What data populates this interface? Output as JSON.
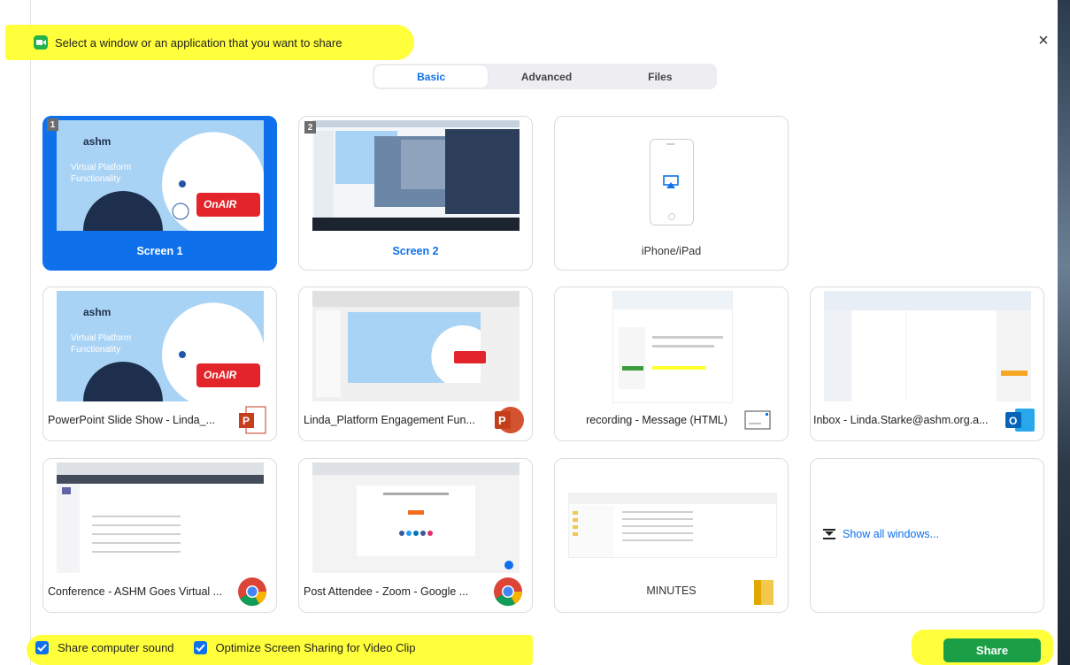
{
  "header": {
    "title": "Select a window or an application that you want to share",
    "close_symbol": "×"
  },
  "tabs": [
    {
      "label": "Basic",
      "active": true
    },
    {
      "label": "Advanced",
      "active": false
    },
    {
      "label": "Files",
      "active": false
    }
  ],
  "tiles": {
    "screen1": {
      "label": "Screen 1",
      "badge": "1",
      "selected": true,
      "slide_brand": "ashm",
      "slide_title": "Virtual Platform",
      "slide_subtitle": "Functionality",
      "slide_onair": "OnAIR"
    },
    "screen2": {
      "label": "Screen 2",
      "badge": "2"
    },
    "iphone": {
      "label": "iPhone/iPad"
    },
    "ppt_show": {
      "label": "PowerPoint Slide Show  -  Linda_...",
      "app_icon": "powerpoint-icon",
      "slide_brand": "ashm",
      "slide_title": "Virtual Platform",
      "slide_subtitle": "Functionality",
      "slide_onair": "OnAIR"
    },
    "ppt_edit": {
      "label": "Linda_Platform Engagement Fun...",
      "app_icon": "powerpoint-icon"
    },
    "recording": {
      "label": "recording - Message (HTML)",
      "app_icon": "message-icon"
    },
    "inbox": {
      "label": "Inbox - Linda.Starke@ashm.org.a...",
      "app_icon": "outlook-icon"
    },
    "conference": {
      "label": "Conference - ASHM Goes Virtual ...",
      "app_icon": "chrome-icon"
    },
    "post_attendee": {
      "label": "Post Attendee - Zoom - Google ...",
      "app_icon": "chrome-icon"
    },
    "minutes": {
      "label": "MINUTES",
      "app_icon": "folder-icon"
    },
    "show_all": {
      "label": "Show all windows..."
    }
  },
  "footer": {
    "share_sound": {
      "label": "Share computer sound",
      "checked": true
    },
    "optimize": {
      "label": "Optimize Screen Sharing for Video Clip",
      "checked": true
    },
    "share_button": "Share"
  },
  "colors": {
    "accent": "#0e71eb",
    "share_green": "#1a9f47",
    "highlight": "#ffff2a",
    "tile_border": "#dcdcdc"
  }
}
